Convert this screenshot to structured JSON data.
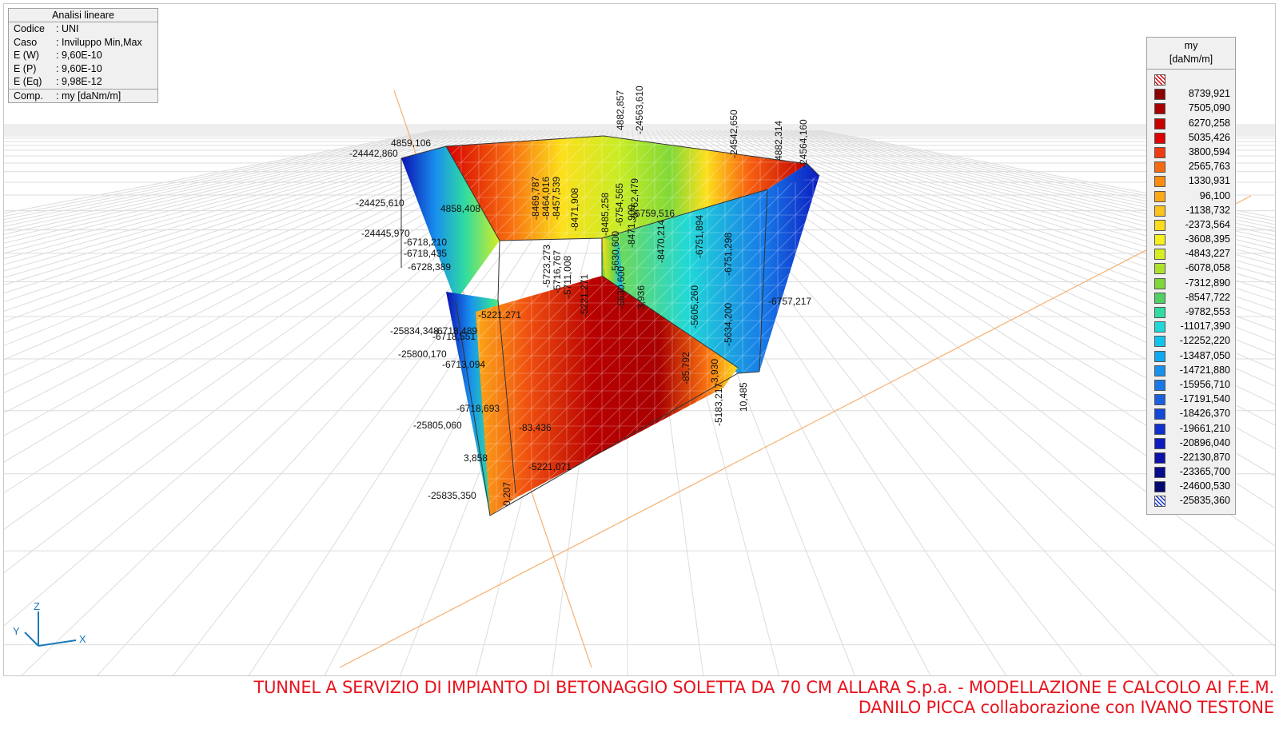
{
  "info": {
    "title": "Analisi lineare",
    "rows": [
      {
        "key": "Codice",
        "value": ": UNI"
      },
      {
        "key": "Caso",
        "value": ": Inviluppo Min,Max"
      },
      {
        "key": "E (W)",
        "value": ": 9,60E-10"
      },
      {
        "key": "E (P)",
        "value": ": 9,60E-10"
      },
      {
        "key": "E (Eq)",
        "value": ": 9,98E-12"
      },
      {
        "key": "Comp.",
        "value": ": my [daNm/m]"
      }
    ]
  },
  "legend": {
    "title": "my",
    "unit": "[daNm/m]",
    "items": [
      {
        "color": "hatch-top",
        "value": ""
      },
      {
        "color": "#8b0000",
        "value": "8739,921"
      },
      {
        "color": "#a80000",
        "value": "7505,090"
      },
      {
        "color": "#c80000",
        "value": "6270,258"
      },
      {
        "color": "#e00000",
        "value": "5035,426"
      },
      {
        "color": "#f23a10",
        "value": "3800,594"
      },
      {
        "color": "#f86a10",
        "value": "2565,763"
      },
      {
        "color": "#fb8c10",
        "value": "1330,931"
      },
      {
        "color": "#fca818",
        "value": "96,100"
      },
      {
        "color": "#fcc41a",
        "value": "-1138,732"
      },
      {
        "color": "#fcdc1c",
        "value": "-2373,564"
      },
      {
        "color": "#f6f01e",
        "value": "-3608,395"
      },
      {
        "color": "#d6ee22",
        "value": "-4843,227"
      },
      {
        "color": "#aee22a",
        "value": "-6078,058"
      },
      {
        "color": "#80d838",
        "value": "-7312,890"
      },
      {
        "color": "#50d060",
        "value": "-8547,722"
      },
      {
        "color": "#30dca0",
        "value": "-9782,553"
      },
      {
        "color": "#20d8d8",
        "value": "-11017,390"
      },
      {
        "color": "#10c4ee",
        "value": "-12252,220"
      },
      {
        "color": "#10a8f0",
        "value": "-13487,050"
      },
      {
        "color": "#1890ee",
        "value": "-14721,880"
      },
      {
        "color": "#1878e8",
        "value": "-15956,710"
      },
      {
        "color": "#1860e0",
        "value": "-17191,540"
      },
      {
        "color": "#1448d8",
        "value": "-18426,370"
      },
      {
        "color": "#1030d0",
        "value": "-19661,210"
      },
      {
        "color": "#0c1cc0",
        "value": "-20896,040"
      },
      {
        "color": "#0a10a8",
        "value": "-22130,870"
      },
      {
        "color": "#060c8c",
        "value": "-23365,700"
      },
      {
        "color": "#040870",
        "value": "-24600,530"
      },
      {
        "color": "hatch-bot",
        "value": "-25835,360"
      }
    ]
  },
  "axes": {
    "z": "Z",
    "y": "Y",
    "x": "X"
  },
  "values": {
    "v01": "4859,106",
    "v02": "-24442,860",
    "v03": "-24425,610",
    "v04": "4858,408",
    "v05": "-24445,970",
    "v06": "-6718,210",
    "v07": "-6718,435",
    "v08": "-6728,389",
    "v09": "-25834,348",
    "v10": "-6718,489",
    "v11": "-6718,551",
    "v12": "-25800,170",
    "v13": "-6713,094",
    "v14": "-6718,693",
    "v15": "-25805,060",
    "v16": "-83,436",
    "v17": "3,858",
    "v18": "-5221,071",
    "v19": "-25835,350",
    "v20": "0,207",
    "v21": "-5221,271",
    "v22": "-8469,787",
    "v23": "-8464,016",
    "v24": "-8457,539",
    "v25": "-8471,908",
    "v26": "-8485,258",
    "v27": "-6754,565",
    "v28": "-6762,479",
    "v29": "-6759,516",
    "v30": "-5630,600",
    "v31": "-8471,909",
    "v32": "-8470,214",
    "v33": "-6751,894",
    "v34": "-6751,298",
    "v35": "-6757,217",
    "v36": "-5605,260",
    "v37": "-5634,200",
    "v38": "-85,792",
    "v39": "3,930",
    "v40": "-5183,217",
    "v41": "10,485",
    "v42": "4882,857",
    "v43": "-24563,610",
    "v44": "-24542,650",
    "v45": "4882,314",
    "v46": "-24564,160",
    "v47": "-5723,273",
    "v48": "-5716,767",
    "v49": "-5711,008",
    "v50": "-5630,600",
    "v51": "-5221,271",
    "v52": "3,936"
  },
  "footer": {
    "line1": "TUNNEL A SERVIZIO DI IMPIANTO DI BETONAGGIO SOLETTA DA 70 CM ALLARA S.p.a. - MODELLAZIONE E CALCOLO AI F.E.M.",
    "line2": "DANILO PICCA collaborazione con IVANO TESTONE"
  }
}
